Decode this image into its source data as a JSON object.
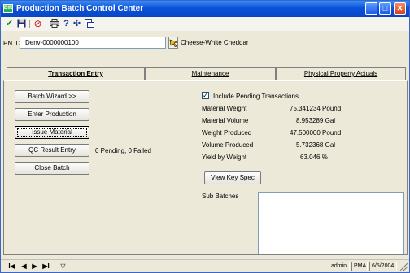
{
  "window": {
    "title": "Production Batch Control Center",
    "icon_label": "BIR"
  },
  "toolbar": {
    "icons": [
      "check-icon",
      "save-icon",
      "cancel-icon",
      "print-icon",
      "help-icon",
      "refresh-icon",
      "window-icon"
    ]
  },
  "pn": {
    "label": "PN ID",
    "value": "Denv-0000000100",
    "description": "Cheese-White Cheddar"
  },
  "tabs": [
    {
      "label": "Transaction Entry",
      "active": true
    },
    {
      "label": "Maintenance",
      "active": false
    },
    {
      "label": "Physical Property Actuals",
      "active": false
    }
  ],
  "actions": {
    "batch_wizard": "Batch Wizard >>",
    "enter_production": "Enter Production",
    "issue_material": "Issue Material",
    "qc_result_entry": "QC Result Entry",
    "close_batch": "Close Batch",
    "qc_status": "0 Pending,  0 Failed"
  },
  "pending": {
    "label": "Include Pending Transactions",
    "checked": "✓"
  },
  "metrics": [
    {
      "label": "Material Weight",
      "value": "75.341234 Pound"
    },
    {
      "label": "Material Volume",
      "value": "8.953289 Gal"
    },
    {
      "label": "Weight Produced",
      "value": "47.500000 Pound"
    },
    {
      "label": "Volume Produced",
      "value": "5.732368 Gal"
    },
    {
      "label": "Yield by Weight",
      "value": "63.046 %"
    }
  ],
  "view_key_spec": "View Key Spec",
  "sub_batches_label": "Sub Batches",
  "status": {
    "user": "admin",
    "org": "PMA",
    "date": "6/5/2004"
  },
  "nav": {
    "first": "I◀",
    "prev": "◀",
    "next": "▶",
    "last": "▶I",
    "filter": "▽"
  }
}
